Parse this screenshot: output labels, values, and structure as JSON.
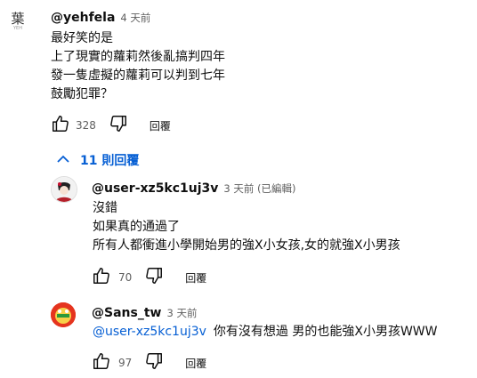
{
  "comment": {
    "avatar_text": "葉",
    "avatar_sub": "YEH",
    "author": "@yehfela",
    "time": "4 天前",
    "lines": [
      "最好笑的是",
      "上了現實的蘿莉然後亂搞判四年",
      "發一隻虛擬的蘿莉可以判到七年",
      "鼓勵犯罪？"
    ],
    "likes": "328",
    "reply_label": "回覆"
  },
  "replies_toggle": {
    "label": "11 則回覆",
    "icon": "chevron-up-icon"
  },
  "replies": [
    {
      "author": "@user-xz5kc1uj3v",
      "time": "3 天前 (已編輯)",
      "lines": [
        "沒錯",
        "如果真的通過了",
        "所有人都衝進小學開始男的強X小女孩,女的就強X小男孩"
      ],
      "likes": "70",
      "reply_label": "回覆"
    },
    {
      "author": "@Sans_tw",
      "time": "3 天前",
      "mention": "@user-xz5kc1uj3v",
      "text": "你有沒有想過 男的也能強X小男孩WWW",
      "likes": "97",
      "reply_label": "回覆"
    }
  ],
  "colors": {
    "link": "#065fd4",
    "meta": "#606060",
    "text": "#0f0f0f"
  }
}
